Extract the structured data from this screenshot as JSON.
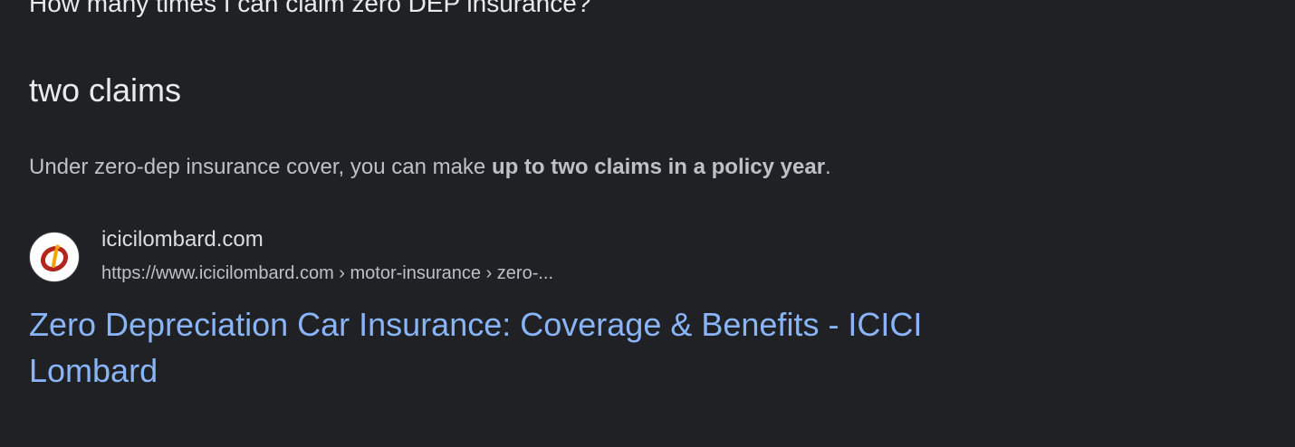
{
  "question": "How many times I can claim zero DEP insurance?",
  "answer": "two claims",
  "snippet": {
    "prefix": "Under zero-dep insurance cover, you can make ",
    "bold": "up to two claims in a policy year",
    "suffix": "."
  },
  "source": {
    "site_name": "icicilombard.com",
    "url_display": "https://www.icicilombard.com › motor-insurance › zero-...",
    "favicon_icon": "icici-lombard-logo-icon",
    "brand_color": "#b3261e"
  },
  "result": {
    "title": "Zero Depreciation Car Insurance: Coverage & Benefits - ICICI Lombard"
  },
  "colors": {
    "background": "#202124",
    "link": "#8ab4f8",
    "text_primary": "#e8eaed",
    "text_secondary": "#bdc1c6"
  }
}
